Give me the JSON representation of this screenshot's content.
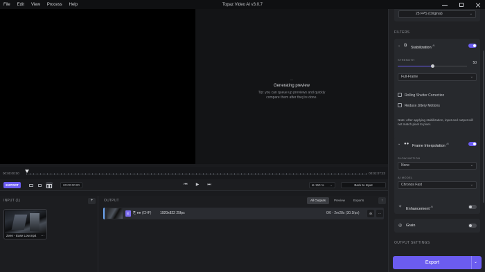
{
  "menu": [
    "File",
    "Edit",
    "View",
    "Process",
    "Help"
  ],
  "app_title": "Topaz Video AI  v3.0.7",
  "preview": {
    "spinner": "..",
    "title": "Generating preview",
    "message": "Tip: you can queue up previews and quickly compare them after they're done."
  },
  "timeline": {
    "start": "00:00:00:00",
    "end": "00:02:07:23",
    "playhead_fraction": 0.0
  },
  "controls": {
    "export_label": "EXPORT",
    "timecode": "00:00:00:00",
    "prev_icon": "skip-back",
    "play_icon": "play",
    "next_icon": "skip-forward",
    "zoom": "150 %",
    "zoom_chevron": "⌄",
    "back_label": "Back to Input"
  },
  "input": {
    "header": "INPUT (1)",
    "add_label": "+",
    "file_name": "Zven - Ease Low.mp4",
    "file_more": "···"
  },
  "output": {
    "header": "OUTPUT",
    "tabs": [
      "All Outputs",
      "Preview",
      "Exports"
    ],
    "active_tab": "All Outputs",
    "up_label": "↑",
    "row": {
      "badge": "E",
      "icons": "⎘  ●● (CHF)",
      "spec": "1920x822  25fps",
      "eta": "0/0 - 2m28s (30.1fps)",
      "btn1": "4k",
      "btn2": "···"
    }
  },
  "settings": {
    "fps_value": "25 FPS (Original)",
    "filters_label": "FILTERS",
    "stabilization": {
      "title": "Stabilization",
      "beta": "AI",
      "enabled": true,
      "strength_label": "STRENGTH",
      "strength": 50,
      "strength_max": 100,
      "mode": "Full-Frame",
      "rolling_shutter": "Rolling Shutter Correction",
      "reduce_jittery": "Reduce Jittery Motions",
      "note": "Note: After applying stabilization, input and output will not match pixel to pixel."
    },
    "frame_interp": {
      "title": "Frame Interpolation",
      "beta": "AI",
      "enabled": true,
      "slow_motion_label": "SLOW MOTION",
      "slow_motion": "None",
      "ai_model_label": "AI MODEL",
      "ai_model": "Chronos Fast"
    },
    "enhancement": {
      "title": "Enhancement",
      "beta": "AI",
      "enabled": false
    },
    "grain": {
      "title": "Grain",
      "enabled": false
    },
    "output_settings_label": "OUTPUT SETTINGS",
    "export_label": "Export"
  },
  "colors": {
    "accent": "#6b5cf0",
    "output_row_marker": "#6fa8f5"
  }
}
